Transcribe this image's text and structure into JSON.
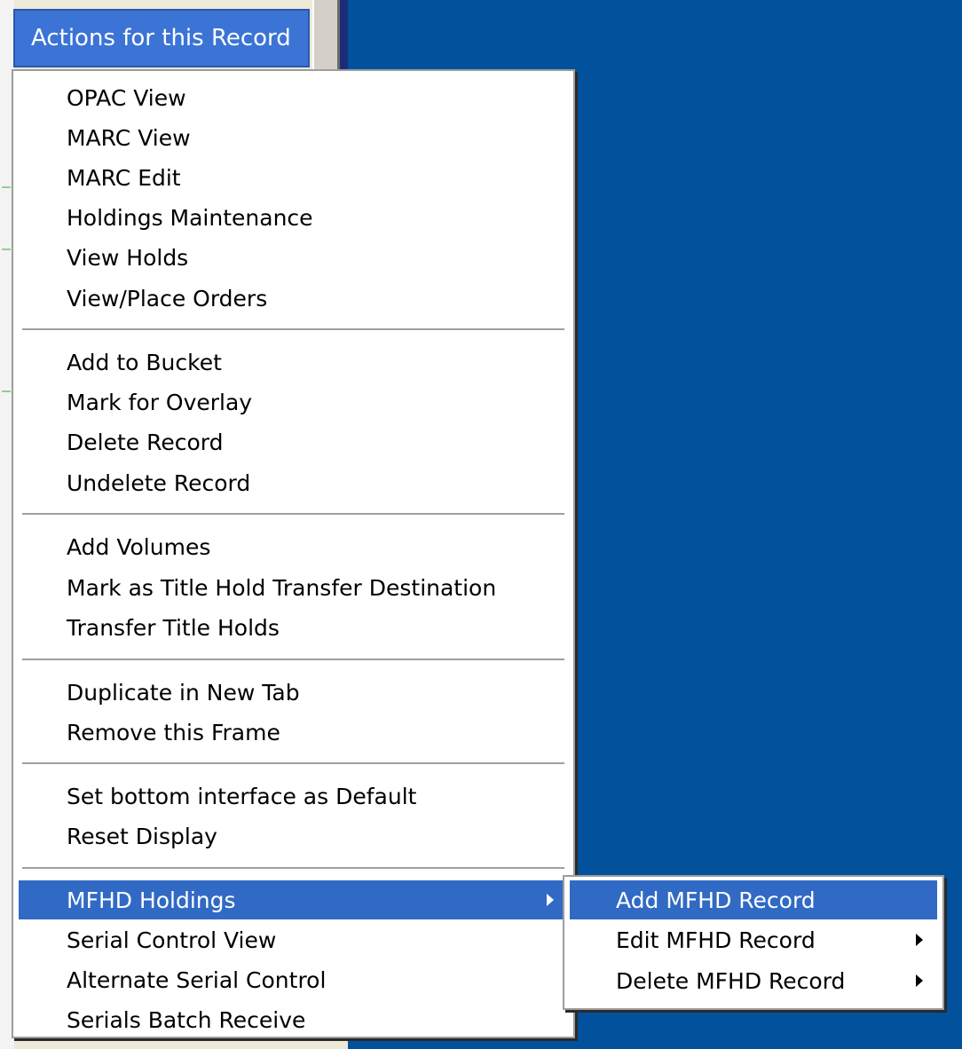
{
  "colors": {
    "desktop_blue": "#02519c",
    "highlight": "#316ac5",
    "menu_button": "#3b74d5"
  },
  "menu_button": {
    "label": "Actions for this Record"
  },
  "menu": {
    "items": [
      {
        "label": "OPAC View"
      },
      {
        "label": "MARC View"
      },
      {
        "label": "MARC Edit"
      },
      {
        "label": "Holdings Maintenance"
      },
      {
        "label": "View Holds"
      },
      {
        "label": "View/Place Orders"
      },
      {
        "label": "Add to Bucket"
      },
      {
        "label": "Mark for Overlay"
      },
      {
        "label": "Delete Record"
      },
      {
        "label": "Undelete Record"
      },
      {
        "label": "Add Volumes"
      },
      {
        "label": "Mark as Title Hold Transfer Destination"
      },
      {
        "label": "Transfer Title Holds"
      },
      {
        "label": "Duplicate in New Tab"
      },
      {
        "label": "Remove this Frame"
      },
      {
        "label": "Set bottom interface as Default"
      },
      {
        "label": "Reset Display"
      },
      {
        "label": "MFHD Holdings"
      },
      {
        "label": "Serial Control View"
      },
      {
        "label": "Alternate Serial Control"
      },
      {
        "label": "Serials Batch Receive"
      }
    ]
  },
  "submenu": {
    "items": [
      {
        "label": "Add MFHD Record"
      },
      {
        "label": "Edit MFHD Record"
      },
      {
        "label": "Delete MFHD Record"
      }
    ]
  }
}
